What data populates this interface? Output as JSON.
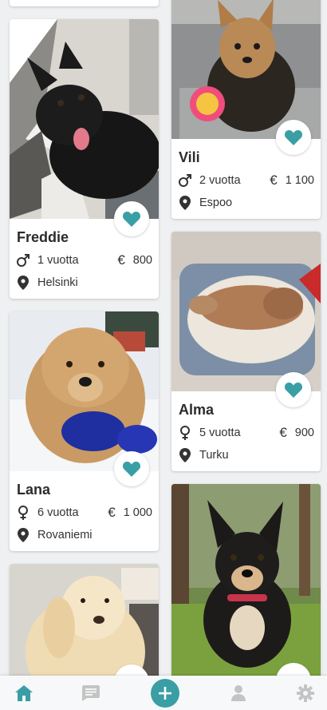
{
  "colors": {
    "accent": "#3a9ea5",
    "muted": "#c4c4c4",
    "background": "#eef0f1"
  },
  "cards": {
    "freddie": {
      "name": "Freddie",
      "gender_icon": "male-icon",
      "age": "1 vuotta",
      "currency": "€",
      "price": "800",
      "location": "Helsinki"
    },
    "vili": {
      "name": "Vili",
      "gender_icon": "male-icon",
      "age": "2 vuotta",
      "currency": "€",
      "price": "1 100",
      "location": "Espoo"
    },
    "alma": {
      "name": "Alma",
      "gender_icon": "female-icon",
      "age": "5 vuotta",
      "currency": "€",
      "price": "900",
      "location": "Turku"
    },
    "lana": {
      "name": "Lana",
      "gender_icon": "female-icon",
      "age": "6 vuotta",
      "currency": "€",
      "price": "1 000",
      "location": "Rovaniemi"
    }
  },
  "bottom_nav": {
    "items": [
      "home-icon",
      "messages-icon",
      "add-icon",
      "profile-icon",
      "settings-icon"
    ],
    "active": "home-icon"
  }
}
